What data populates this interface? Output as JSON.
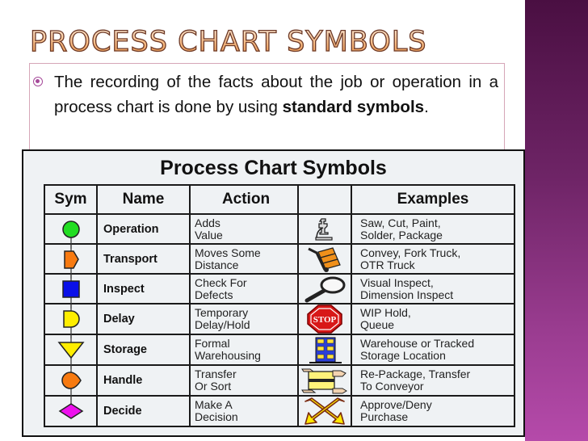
{
  "slide": {
    "title": "PROCESS CHART SYMBOLS",
    "bullet": {
      "text_before": "The recording of the facts about the job or operation in a process chart is done by using ",
      "bold": "standard symbols",
      "text_after": "."
    }
  },
  "figure": {
    "title": "Process Chart Symbols",
    "headers": {
      "sym": "Sym",
      "name": "Name",
      "action": "Action",
      "icon": "",
      "examples": "Examples"
    },
    "rows": [
      {
        "symbol": "circle-green",
        "name": "Operation",
        "action1": "Adds",
        "action2": "Value",
        "icon": "microscope-icon",
        "ex1": "Saw, Cut, Paint,",
        "ex2": "Solder, Package"
      },
      {
        "symbol": "arrow-orange",
        "name": "Transport",
        "action1": "Moves Some",
        "action2": "Distance",
        "icon": "hand-truck-icon",
        "ex1": "Convey, Fork Truck,",
        "ex2": "OTR Truck"
      },
      {
        "symbol": "square-blue",
        "name": "Inspect",
        "action1": "Check For",
        "action2": "Defects",
        "icon": "magnifier-icon",
        "ex1": "Visual Inspect,",
        "ex2": "Dimension Inspect"
      },
      {
        "symbol": "d-yellow",
        "name": "Delay",
        "action1": "Temporary",
        "action2": "Delay/Hold",
        "icon": "stop-sign-icon",
        "ex1": "WIP Hold,",
        "ex2": "Queue",
        "stop_label": "STOP"
      },
      {
        "symbol": "triangle-yellow",
        "name": "Storage",
        "action1": "Formal",
        "action2": "Warehousing",
        "icon": "warehouse-icon",
        "ex1": "Warehouse or Tracked",
        "ex2": "Storage Location"
      },
      {
        "symbol": "teardrop-orange",
        "name": "Handle",
        "action1": "Transfer",
        "action2": "Or Sort",
        "icon": "hands-box-icon",
        "ex1": "Re-Package, Transfer",
        "ex2": "To Conveyor"
      },
      {
        "symbol": "diamond-magenta",
        "name": "Decide",
        "action1": "Make A",
        "action2": "Decision",
        "icon": "crossed-arrows-icon",
        "ex1": "Approve/Deny",
        "ex2": "Purchase"
      }
    ]
  },
  "colors": {
    "operation": "#22dd22",
    "transport": "#f77a10",
    "inspect": "#0a10e8",
    "delay": "#ffee00",
    "storage": "#ffee00",
    "handle": "#f77a10",
    "decide": "#ee11ee",
    "accent": "#a64a9a"
  }
}
